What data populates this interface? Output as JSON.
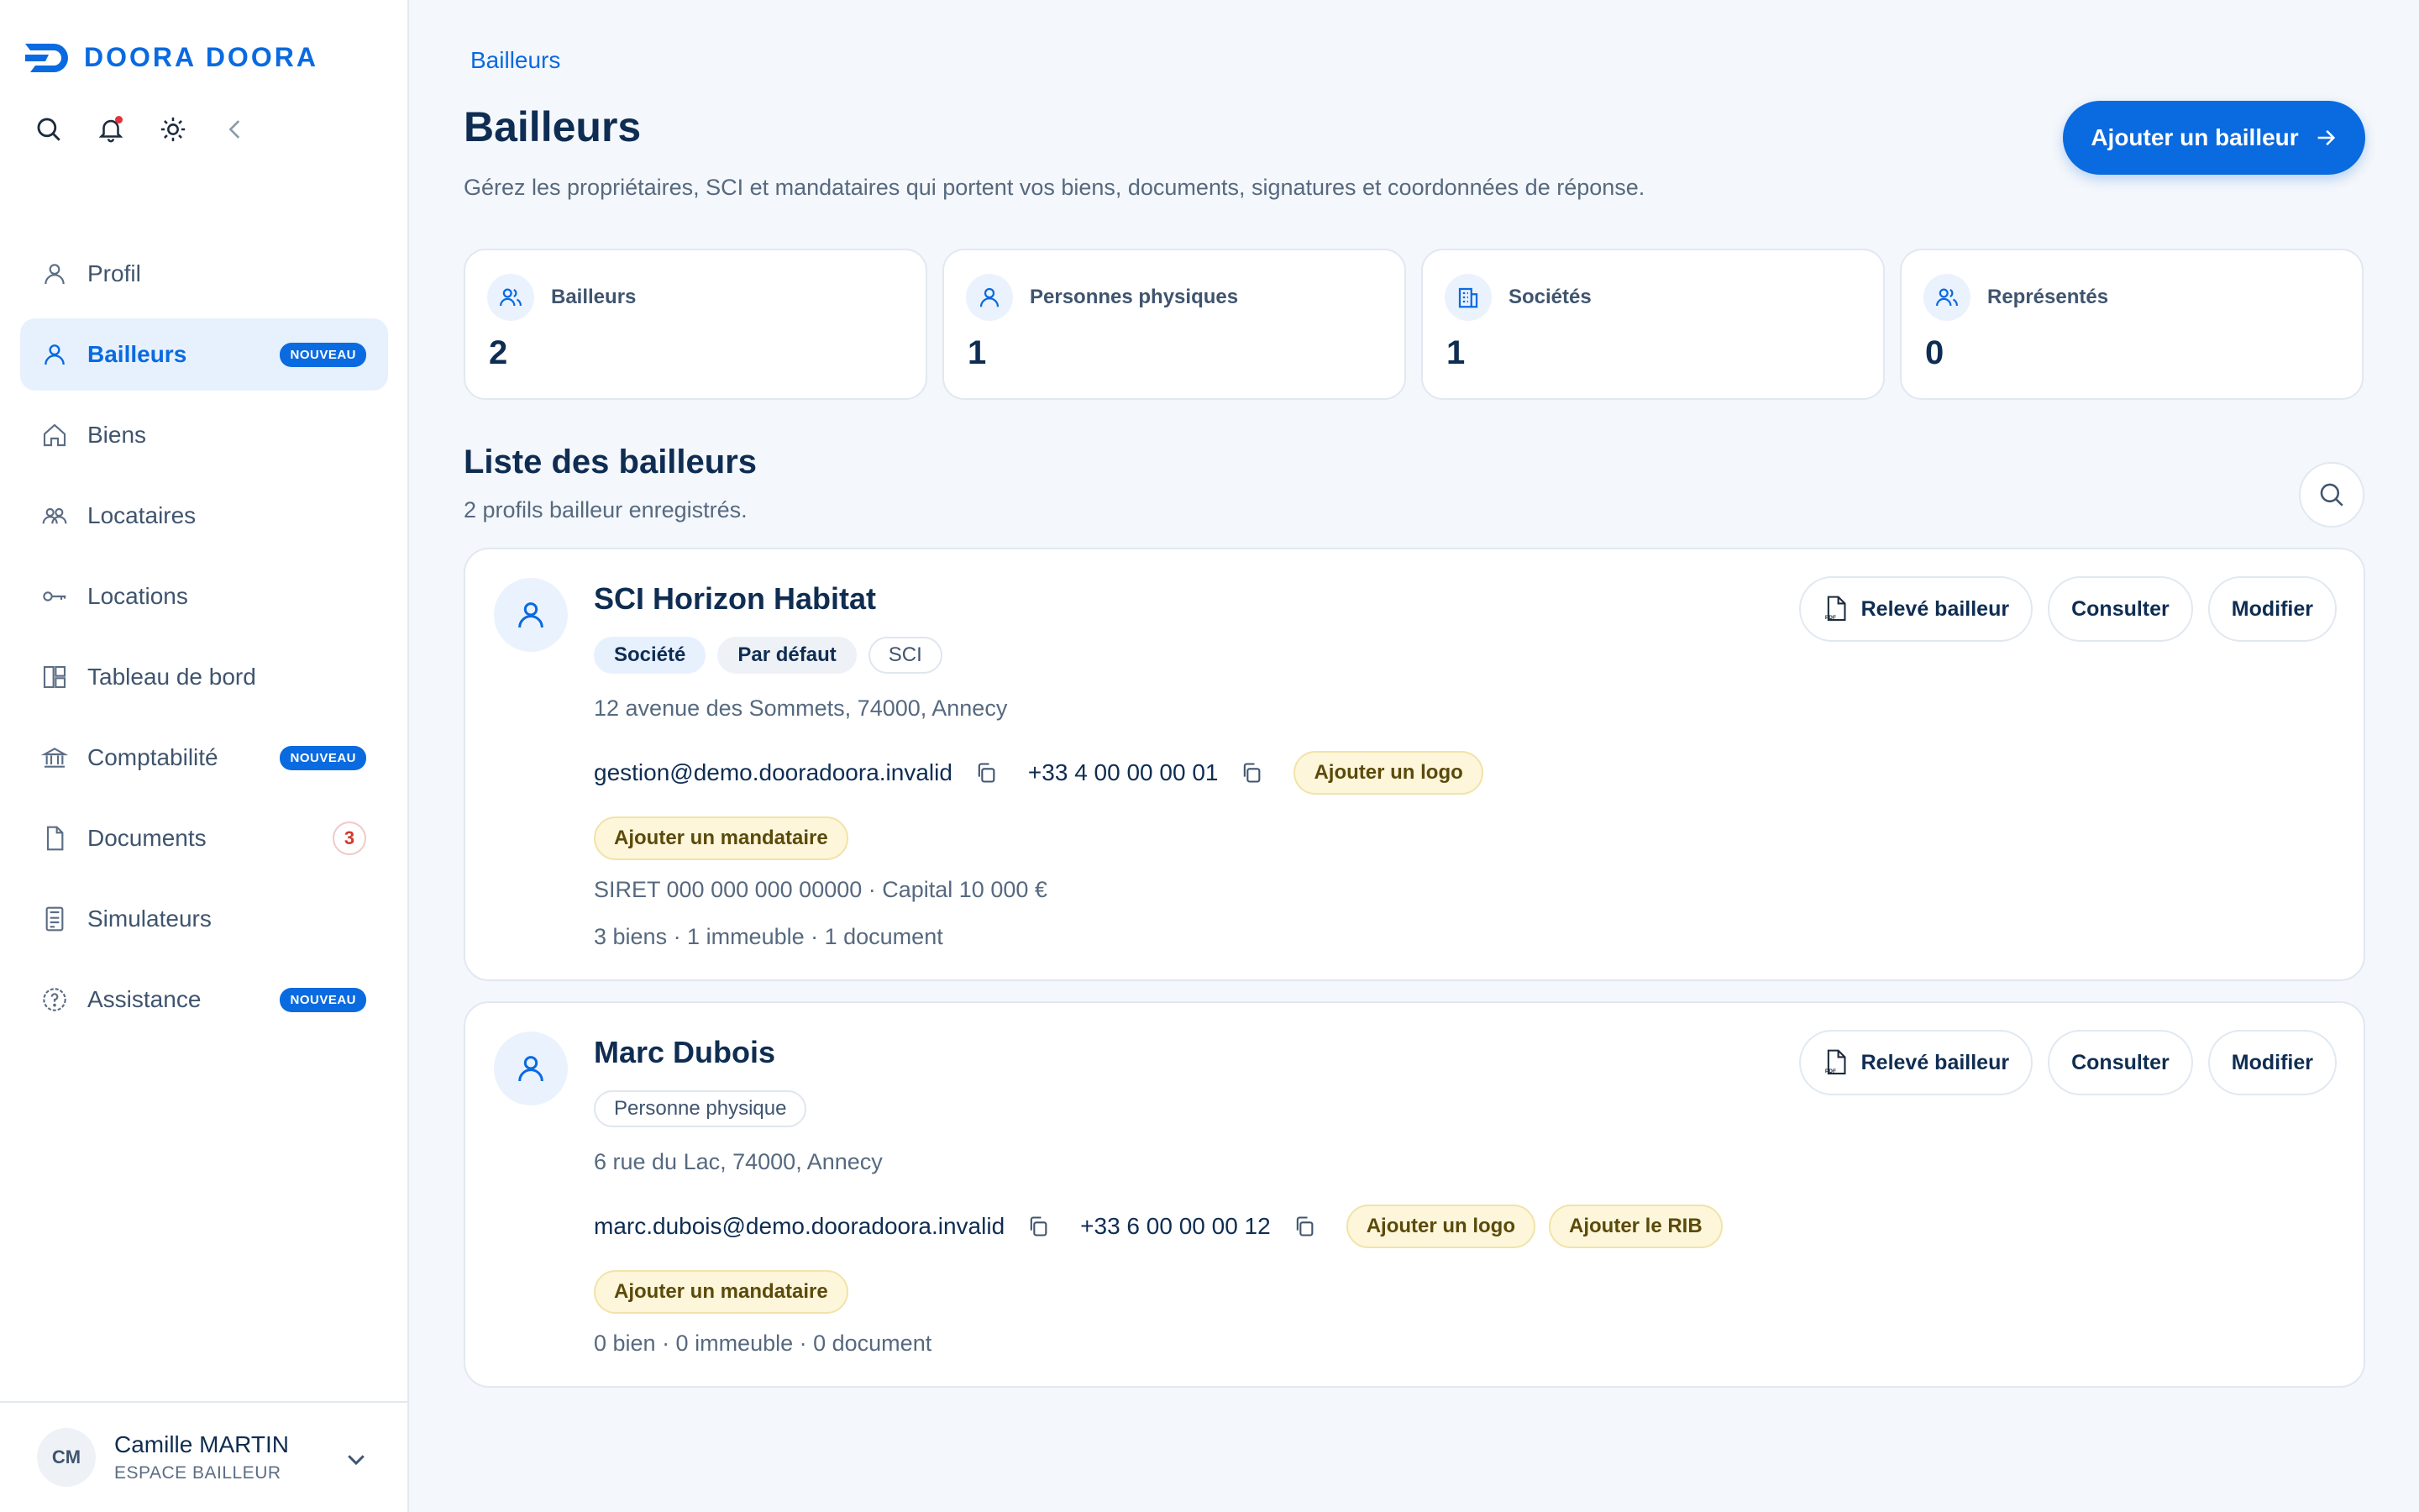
{
  "brand": {
    "name": "DOORA DOORA",
    "color": "#0a6ae0"
  },
  "sidebar": {
    "items": [
      {
        "label": "Profil",
        "icon": "user-icon",
        "active": false
      },
      {
        "label": "Bailleurs",
        "icon": "user-icon",
        "active": true,
        "badge": "NOUVEAU"
      },
      {
        "label": "Biens",
        "icon": "home-icon",
        "active": false
      },
      {
        "label": "Locataires",
        "icon": "users-icon",
        "active": false
      },
      {
        "label": "Locations",
        "icon": "key-icon",
        "active": false
      },
      {
        "label": "Tableau de bord",
        "icon": "dashboard-icon",
        "active": false
      },
      {
        "label": "Comptabilité",
        "icon": "bank-icon",
        "active": false,
        "badge": "NOUVEAU"
      },
      {
        "label": "Documents",
        "icon": "file-icon",
        "active": false,
        "count": "3"
      },
      {
        "label": "Simulateurs",
        "icon": "calculator-icon",
        "active": false
      },
      {
        "label": "Assistance",
        "icon": "help-icon",
        "active": false,
        "badge": "NOUVEAU"
      }
    ],
    "user": {
      "initials": "CM",
      "name": "Camille MARTIN",
      "role": "ESPACE BAILLEUR"
    }
  },
  "header": {
    "breadcrumb": "Bailleurs",
    "title": "Bailleurs",
    "subtitle": "Gérez les propriétaires, SCI et mandataires qui portent vos biens, documents, signatures et coordonnées de réponse.",
    "add_button": "Ajouter un bailleur"
  },
  "stats": [
    {
      "label": "Bailleurs",
      "value": "2",
      "icon": "users-icon"
    },
    {
      "label": "Personnes physiques",
      "value": "1",
      "icon": "user-icon"
    },
    {
      "label": "Sociétés",
      "value": "1",
      "icon": "building-icon"
    },
    {
      "label": "Représentés",
      "value": "0",
      "icon": "users-icon"
    }
  ],
  "list": {
    "title": "Liste des bailleurs",
    "subtitle": "2 profils bailleur enregistrés."
  },
  "actions": {
    "statement": "Relevé bailleur",
    "view": "Consulter",
    "edit": "Modifier"
  },
  "landlords": [
    {
      "name": "SCI Horizon Habitat",
      "tags": [
        "Société",
        "Par défaut",
        "SCI"
      ],
      "address": "12 avenue des Sommets, 74000, Annecy",
      "email": "gestion@demo.dooradoora.invalid",
      "phone": "+33 4 00 00 00 01",
      "pills": [
        "Ajouter un logo"
      ],
      "mandataire": "Ajouter un mandataire",
      "legal": "SIRET 000 000 000 00000 · Capital 10 000 €",
      "summary": "3 biens · 1 immeuble · 1 document"
    },
    {
      "name": "Marc Dubois",
      "tags": [
        "Personne physique"
      ],
      "address": "6 rue du Lac, 74000, Annecy",
      "email": "marc.dubois@demo.dooradoora.invalid",
      "phone": "+33 6 00 00 00 12",
      "pills": [
        "Ajouter un logo",
        "Ajouter le RIB"
      ],
      "mandataire": "Ajouter un mandataire",
      "summary": "0 bien · 0 immeuble · 0 document"
    }
  ]
}
